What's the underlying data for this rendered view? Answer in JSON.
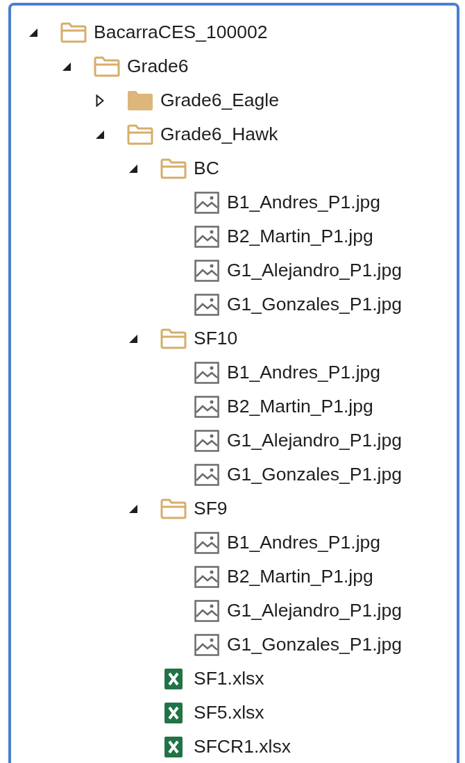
{
  "tree": [
    {
      "label": "BacarraCES_100002",
      "kind": "folder",
      "expanded": true,
      "children": [
        {
          "label": "Grade6",
          "kind": "folder",
          "expanded": true,
          "children": [
            {
              "label": "Grade6_Eagle",
              "kind": "folder",
              "expanded": false
            },
            {
              "label": "Grade6_Hawk",
              "kind": "folder",
              "expanded": true,
              "children": [
                {
                  "label": "BC",
                  "kind": "folder",
                  "expanded": true,
                  "children": [
                    {
                      "label": "B1_Andres_P1.jpg",
                      "kind": "image"
                    },
                    {
                      "label": "B2_Martin_P1.jpg",
                      "kind": "image"
                    },
                    {
                      "label": "G1_Alejandro_P1.jpg",
                      "kind": "image"
                    },
                    {
                      "label": "G1_Gonzales_P1.jpg",
                      "kind": "image"
                    }
                  ]
                },
                {
                  "label": "SF10",
                  "kind": "folder",
                  "expanded": true,
                  "children": [
                    {
                      "label": "B1_Andres_P1.jpg",
                      "kind": "image"
                    },
                    {
                      "label": "B2_Martin_P1.jpg",
                      "kind": "image"
                    },
                    {
                      "label": "G1_Alejandro_P1.jpg",
                      "kind": "image"
                    },
                    {
                      "label": "G1_Gonzales_P1.jpg",
                      "kind": "image"
                    }
                  ]
                },
                {
                  "label": "SF9",
                  "kind": "folder",
                  "expanded": true,
                  "children": [
                    {
                      "label": "B1_Andres_P1.jpg",
                      "kind": "image"
                    },
                    {
                      "label": "B2_Martin_P1.jpg",
                      "kind": "image"
                    },
                    {
                      "label": "G1_Alejandro_P1.jpg",
                      "kind": "image"
                    },
                    {
                      "label": "G1_Gonzales_P1.jpg",
                      "kind": "image"
                    }
                  ]
                },
                {
                  "label": "SF1.xlsx",
                  "kind": "excel"
                },
                {
                  "label": "SF5.xlsx",
                  "kind": "excel"
                },
                {
                  "label": "SFCR1.xlsx",
                  "kind": "excel"
                }
              ]
            }
          ]
        }
      ]
    }
  ]
}
